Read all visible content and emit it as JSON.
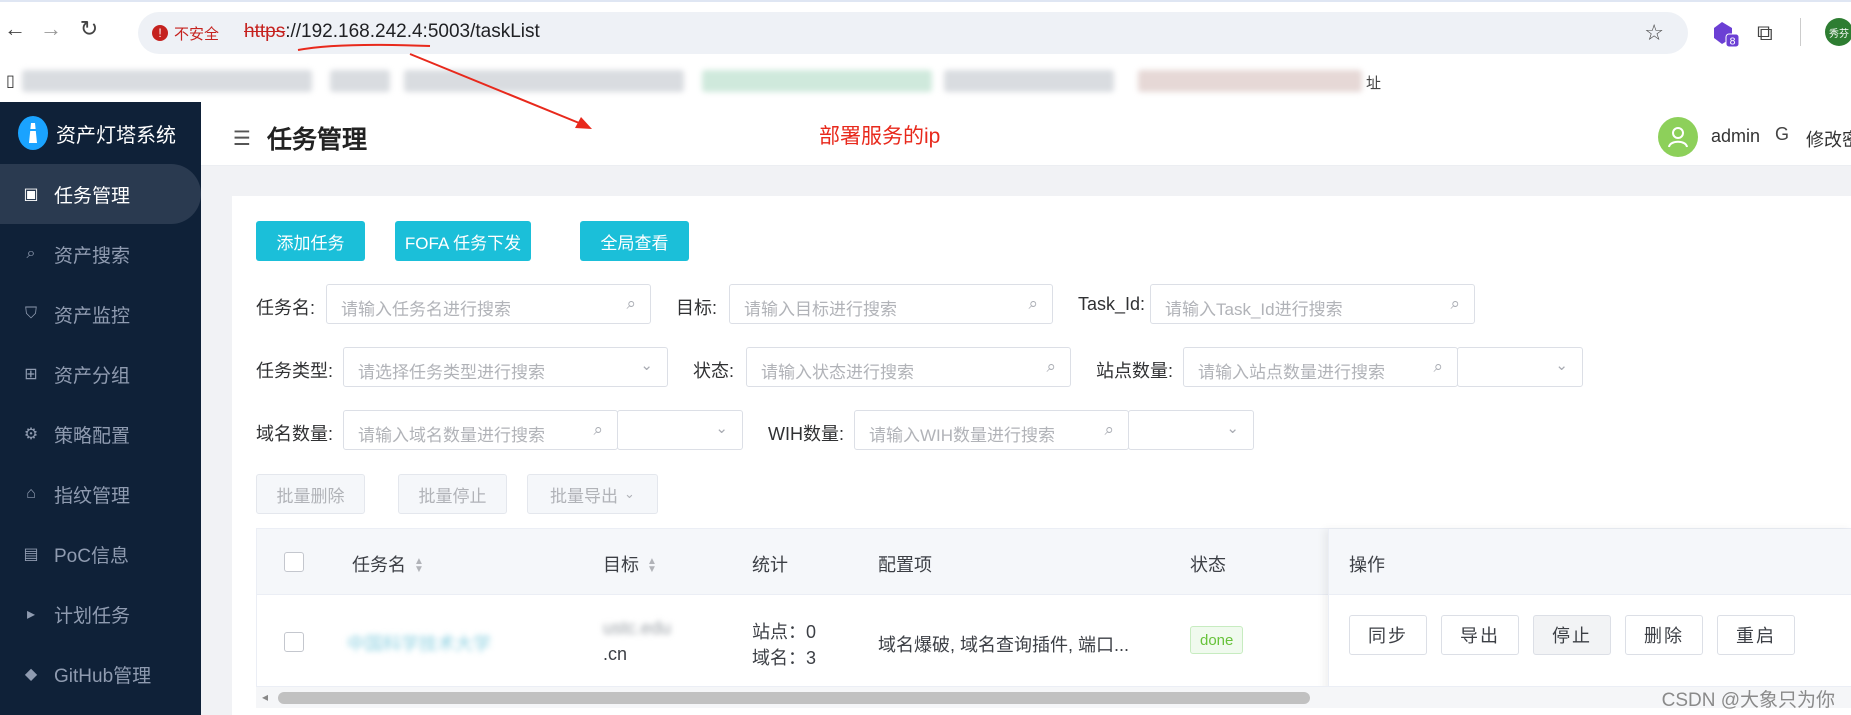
{
  "browser": {
    "security_label": "不安全",
    "url_scheme": "https",
    "url_host": "://192.168.242.4",
    "url_rest": ":5003/taskList",
    "extension_badge": "8",
    "profile_label": "秀芬",
    "bookmark_tail": "址"
  },
  "annotation": {
    "text": "部署服务的ip"
  },
  "app": {
    "name": "资产灯塔系统"
  },
  "sidebar": {
    "items": [
      {
        "label": "任务管理",
        "icon": "clipboard-icon",
        "active": true
      },
      {
        "label": "资产搜索",
        "icon": "search-icon"
      },
      {
        "label": "资产监控",
        "icon": "shield-icon"
      },
      {
        "label": "资产分组",
        "icon": "sitemap-icon"
      },
      {
        "label": "策略配置",
        "icon": "cog-icon"
      },
      {
        "label": "指纹管理",
        "icon": "tag-icon"
      },
      {
        "label": "PoC信息",
        "icon": "document-icon"
      },
      {
        "label": "计划任务",
        "icon": "terminal-icon"
      },
      {
        "label": "GitHub管理",
        "icon": "github-icon"
      }
    ]
  },
  "header": {
    "title": "任务管理",
    "username": "admin",
    "change_password": "修改密"
  },
  "toolbar": {
    "add_task": "添加任务",
    "fofa_task": "FOFA 任务下发",
    "global_view": "全局查看"
  },
  "filters": {
    "task_name": {
      "label": "任务名:",
      "placeholder": "请输入任务名进行搜索"
    },
    "target": {
      "label": "目标:",
      "placeholder": "请输入目标进行搜索"
    },
    "task_id": {
      "label": "Task_Id:",
      "placeholder": "请输入Task_Id进行搜索"
    },
    "task_type": {
      "label": "任务类型:",
      "placeholder": "请选择任务类型进行搜索"
    },
    "status": {
      "label": "状态:",
      "placeholder": "请输入状态进行搜索"
    },
    "site_count": {
      "label": "站点数量:",
      "placeholder": "请输入站点数量进行搜索"
    },
    "domain_count": {
      "label": "域名数量:",
      "placeholder": "请输入域名数量进行搜索"
    },
    "wih_count": {
      "label": "WIH数量:",
      "placeholder": "请输入WIH数量进行搜索"
    }
  },
  "batch": {
    "delete": "批量删除",
    "stop": "批量停止",
    "export": "批量导出"
  },
  "table": {
    "columns": [
      "任务名",
      "目标",
      "统计",
      "配置项",
      "状态",
      "操作"
    ],
    "rows": [
      {
        "name": "中国科学技术大学",
        "target_line1": "ustc.edu",
        "target_line2": ".cn",
        "stats_sites": "站点：0",
        "stats_domains": "域名：3",
        "config": "域名爆破, 域名查询插件, 端口...",
        "status": "done",
        "actions": [
          "同步",
          "导出",
          "停止",
          "删除",
          "重启"
        ]
      }
    ]
  },
  "watermark": "CSDN @大象只为你"
}
